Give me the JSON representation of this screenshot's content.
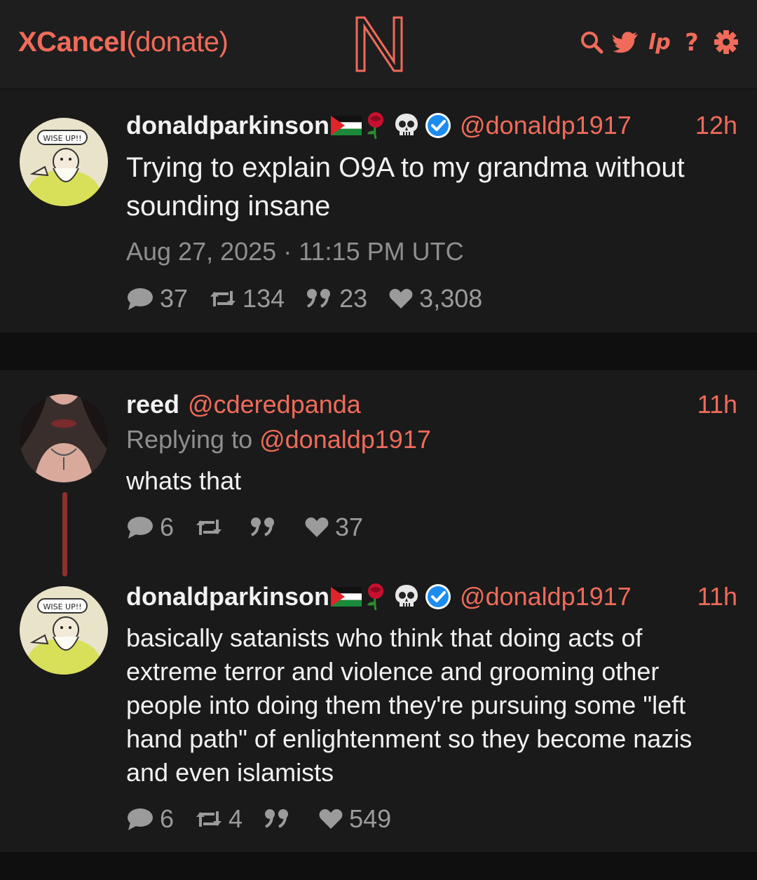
{
  "nav": {
    "brand_main": "XCancel",
    "brand_sub": "(donate)",
    "icons": [
      "search-icon",
      "twitter-bird-icon",
      "rss-icon",
      "help-icon",
      "gear-icon"
    ],
    "accent": "#f06b5a"
  },
  "main_tweet": {
    "username": "donaldparkinson",
    "handle": "@donaldp1917",
    "time": "12h",
    "text": "Trying to explain O9A to my grandma without sounding insane",
    "date": "Aug 27, 2025 · 11:15 PM UTC",
    "stats": {
      "replies": "37",
      "retweets": "134",
      "quotes": "23",
      "likes": "3,308"
    }
  },
  "reply_tweet": {
    "username": "reed",
    "handle": "@cderedpanda",
    "time": "11h",
    "replying_prefix": "Replying to ",
    "replying_handle": "@donaldp1917",
    "text": "whats that",
    "stats": {
      "replies": "6",
      "retweets": "",
      "quotes": "",
      "likes": "37"
    }
  },
  "second_tweet": {
    "username": "donaldparkinson",
    "handle": "@donaldp1917",
    "time": "11h",
    "text": "basically satanists who think that doing acts of extreme terror and violence and grooming other people into doing them they're pursuing some \"left hand path\" of enlightenment so they become nazis and even islamists",
    "stats": {
      "replies": "6",
      "retweets": "4",
      "quotes": "",
      "likes": "549"
    }
  },
  "avatar_label": "WISE UP!!"
}
